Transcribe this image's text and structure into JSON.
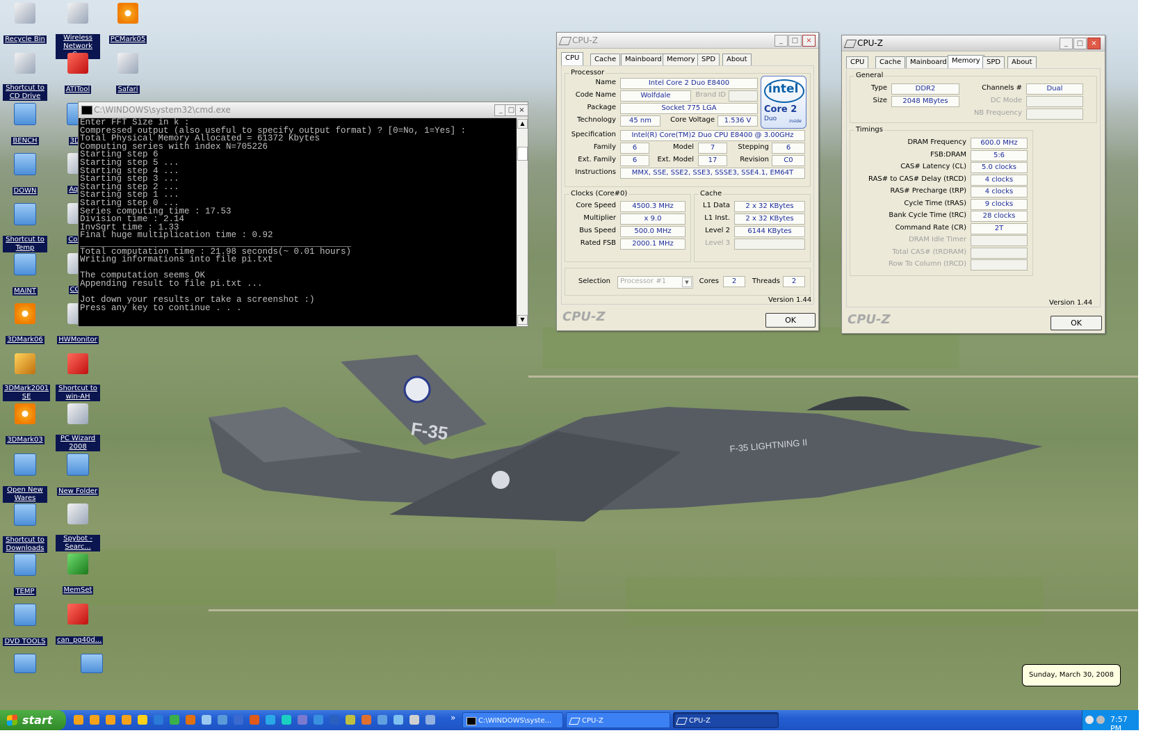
{
  "desktop_icons": [
    {
      "label": "Recycle Bin",
      "icon": "recycle-bin-icon"
    },
    {
      "label": "Wireless Network C...",
      "icon": "network-icon"
    },
    {
      "label": "PCMark05",
      "icon": "pcmark-icon"
    },
    {
      "label": "Shortcut to CD Drive",
      "icon": "cd-drive-icon"
    },
    {
      "label": "ATITool",
      "icon": "atitool-icon"
    },
    {
      "label": "Safari",
      "icon": "safari-icon"
    },
    {
      "label": "BENCH",
      "icon": "folder-icon"
    },
    {
      "label": "3DM",
      "icon": "folder-icon"
    },
    {
      "label": "DOWN",
      "icon": "folder-icon"
    },
    {
      "label": "Aqua",
      "icon": "aqua-icon"
    },
    {
      "label": "Shortcut to Temp",
      "icon": "folder-icon"
    },
    {
      "label": "Contr",
      "icon": "control-icon"
    },
    {
      "label": "MAINT",
      "icon": "folder-icon"
    },
    {
      "label": "CCle",
      "icon": "ccleaner-icon"
    },
    {
      "label": "3DMark06",
      "icon": "3dmark-icon"
    },
    {
      "label": "HWMonitor",
      "icon": "hwmonitor-icon"
    },
    {
      "label": "3DMark2001 SE",
      "icon": "3dmark2001-icon"
    },
    {
      "label": "Shortcut to win-AH",
      "icon": "gear-icon"
    },
    {
      "label": "3DMark03",
      "icon": "3dmark-icon"
    },
    {
      "label": "PC Wizard 2008",
      "icon": "pcwizard-icon"
    },
    {
      "label": "Open New Wares",
      "icon": "folder-icon"
    },
    {
      "label": "New Folder",
      "icon": "folder-icon"
    },
    {
      "label": "Shortcut to Downloads",
      "icon": "folder-icon"
    },
    {
      "label": "Spybot - Searc...",
      "icon": "spybot-icon"
    },
    {
      "label": "TEMP",
      "icon": "folder-icon"
    },
    {
      "label": "MemSet",
      "icon": "memory-icon"
    },
    {
      "label": "DVD TOOLS",
      "icon": "folder-icon"
    },
    {
      "label": "can_pg40d...",
      "icon": "pdf-icon"
    }
  ],
  "cmd": {
    "title": "C:\\WINDOWS\\system32\\cmd.exe",
    "lines": [
      "Enter FFT Size in k :",
      "Compressed output (also useful to specify output format) ? [0=No, 1=Yes] :",
      "Total Physical Memory Allocated = 61372 Kbytes",
      "Computing series with index N=705226",
      "Starting step 6",
      "Starting step 5 ...",
      "Starting step 4 ...",
      "Starting step 3 ...",
      "Starting step 2 ...",
      "Starting step 1 ...",
      "Starting step 0 ...",
      "Series computing time : 17.53",
      "Division time : 2.14",
      "InvSqrt time : 1.33",
      "Final huge multiplication time : 0.92",
      "____________________________________________________",
      "Total computation time : 21.98 seconds(~ 0.01 hours)",
      "Writing informations into file pi.txt",
      "",
      "The computation seems OK",
      "Appending result to file pi.txt ...",
      "",
      "Jot down your results or take a screenshot :)",
      "Press any key to continue . . ."
    ]
  },
  "cpuz1": {
    "title": "CPU-Z",
    "tabs": [
      "CPU",
      "Cache",
      "Mainboard",
      "Memory",
      "SPD",
      "About"
    ],
    "processor": {
      "group": "Processor",
      "name_label": "Name",
      "name": "Intel Core 2 Duo E8400",
      "codename_label": "Code Name",
      "codename": "Wolfdale",
      "brandid_label": "Brand ID",
      "package_label": "Package",
      "package": "Socket 775 LGA",
      "tech_label": "Technology",
      "tech": "45 nm",
      "voltage_label": "Core Voltage",
      "voltage": "1.536 V",
      "spec_label": "Specification",
      "spec": "Intel(R) Core(TM)2 Duo CPU     E8400  @ 3.00GHz",
      "family_label": "Family",
      "family": "6",
      "model_label": "Model",
      "model": "7",
      "stepping_label": "Stepping",
      "stepping": "6",
      "extfamily_label": "Ext. Family",
      "extfamily": "6",
      "extmodel_label": "Ext. Model",
      "extmodel": "17",
      "revision_label": "Revision",
      "revision": "C0",
      "instr_label": "Instructions",
      "instr": "MMX, SSE, SSE2, SSE3, SSSE3, SSE4.1, EM64T"
    },
    "logo": {
      "brand": "intel",
      "line1": "Core 2",
      "line2": "Duo",
      "tag": "inside"
    },
    "clocks": {
      "group": "Clocks (Core#0)",
      "core_label": "Core Speed",
      "core": "4500.3 MHz",
      "mult_label": "Multiplier",
      "mult": "x 9.0",
      "bus_label": "Bus Speed",
      "bus": "500.0 MHz",
      "fsb_label": "Rated FSB",
      "fsb": "2000.1 MHz"
    },
    "cache": {
      "group": "Cache",
      "l1d_label": "L1 Data",
      "l1d": "2 x 32 KBytes",
      "l1i_label": "L1 Inst.",
      "l1i": "2 x 32 KBytes",
      "l2_label": "Level 2",
      "l2": "6144 KBytes",
      "l3_label": "Level 3"
    },
    "selection_label": "Selection",
    "selection": "Processor #1",
    "cores_label": "Cores",
    "cores": "2",
    "threads_label": "Threads",
    "threads": "2",
    "version": "Version 1.44",
    "brand": "CPU-Z",
    "ok": "OK"
  },
  "cpuz2": {
    "title": "CPU-Z",
    "tabs": [
      "CPU",
      "Cache",
      "Mainboard",
      "Memory",
      "SPD",
      "About"
    ],
    "general": {
      "group": "General",
      "type_label": "Type",
      "type": "DDR2",
      "size_label": "Size",
      "size": "2048 MBytes",
      "channels_label": "Channels #",
      "channels": "Dual",
      "dcmode_label": "DC Mode",
      "nb_label": "NB Frequency"
    },
    "timings": {
      "group": "Timings",
      "rows": [
        {
          "label": "DRAM Frequency",
          "value": "600.0 MHz",
          "dim": false
        },
        {
          "label": "FSB:DRAM",
          "value": "5:6",
          "dim": false
        },
        {
          "label": "CAS# Latency (CL)",
          "value": "5.0 clocks",
          "dim": false
        },
        {
          "label": "RAS# to CAS# Delay (tRCD)",
          "value": "4 clocks",
          "dim": false
        },
        {
          "label": "RAS# Precharge (tRP)",
          "value": "4 clocks",
          "dim": false
        },
        {
          "label": "Cycle Time (tRAS)",
          "value": "9 clocks",
          "dim": false
        },
        {
          "label": "Bank Cycle Time (tRC)",
          "value": "28 clocks",
          "dim": false
        },
        {
          "label": "Command Rate (CR)",
          "value": "2T",
          "dim": false
        },
        {
          "label": "DRAM Idle Timer",
          "value": "",
          "dim": true
        },
        {
          "label": "Total CAS# (tRDRAM)",
          "value": "",
          "dim": true
        },
        {
          "label": "Row To Column (tRCD)",
          "value": "",
          "dim": true
        }
      ]
    },
    "version": "Version 1.44",
    "brand": "CPU-Z",
    "ok": "OK"
  },
  "taskbar": {
    "start": "start",
    "tasks": [
      "C:\\WINDOWS\\syste...",
      "CPU-Z",
      "CPU-Z"
    ],
    "clock": "7:57 PM",
    "tooltip": "Sunday, March 30, 2008",
    "overflow": "»"
  },
  "wallpaper": {
    "tail_text": "F-35",
    "fuselage_text": "F-35 LIGHTNING II"
  }
}
